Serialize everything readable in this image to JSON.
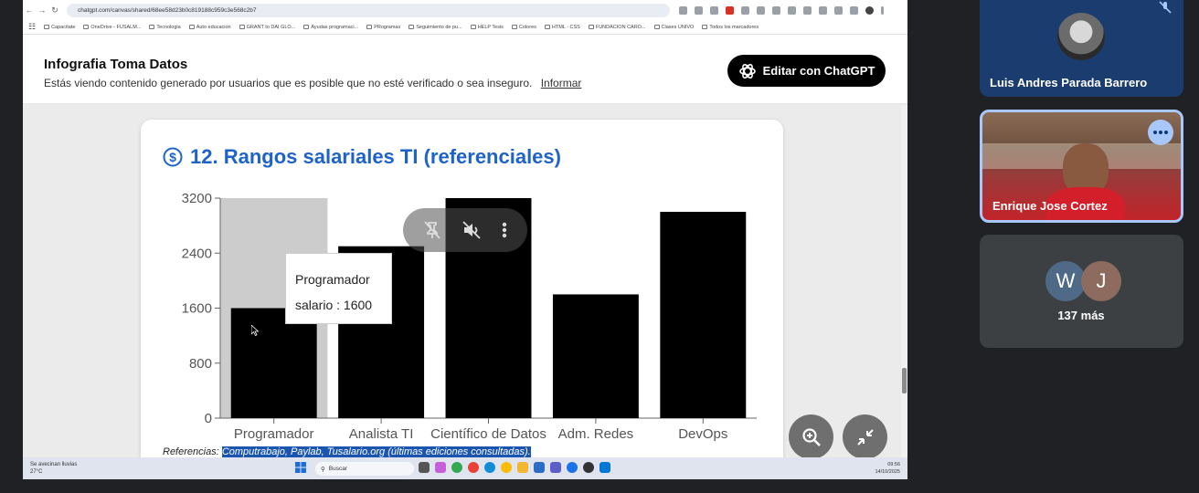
{
  "browser": {
    "url": "chatgpt.com/canvas/shared/68ee58d23b0c819188c959c3e568c2b7",
    "bookmarks": [
      "Capacitate",
      "OneDrive - FUSALM...",
      "Tecnologia",
      "Auto educacion",
      "GRANT to DAI GLO...",
      "Ayudas programaci...",
      "PRogramas",
      "Seguimiento de pu...",
      "HELP Tesis",
      "Colores",
      "HTML - CSS",
      "FUNDACION CARO...",
      "Clases UNIVO",
      "Todos los marcadores"
    ]
  },
  "chatgpt": {
    "title": "Infografia Toma Datos",
    "notice": "Estás viendo contenido generado por usuarios que es posible que no esté verificado o sea inseguro.",
    "report_link": "Informar",
    "edit_button": "Editar con ChatGPT"
  },
  "section": {
    "title": "12. Rangos salariales TI (referenciales)",
    "references_label": "Referencias:",
    "references_text": "Computrabajo, Paylab, Tusalario.org (últimas ediciones consultadas)."
  },
  "chart_data": {
    "type": "bar",
    "categories": [
      "Programador",
      "Analista TI",
      "Científico de Datos",
      "Adm. Redes",
      "DevOps"
    ],
    "values": [
      1600,
      2500,
      3200,
      1800,
      3000
    ],
    "y_ticks": [
      0,
      800,
      1600,
      2400,
      3200
    ],
    "ylim": [
      0,
      3200
    ],
    "bar_color": "#000000",
    "highlight_color": "#cccccc",
    "highlighted_index": 0,
    "tooltip": {
      "category": "Programador",
      "text": "salario : 1600"
    }
  },
  "taskbar": {
    "weather_line1": "Se avecinan lluvias",
    "weather_line2": "27°C",
    "search_placeholder": "Buscar",
    "time": "09:56",
    "date": "14/10/2025"
  },
  "participants": [
    {
      "name": "Luis Andres Parada Barrero"
    },
    {
      "name": "Enrique Jose Cortez"
    }
  ],
  "others": {
    "initials": [
      "W",
      "J"
    ],
    "count_label": "137 más"
  }
}
